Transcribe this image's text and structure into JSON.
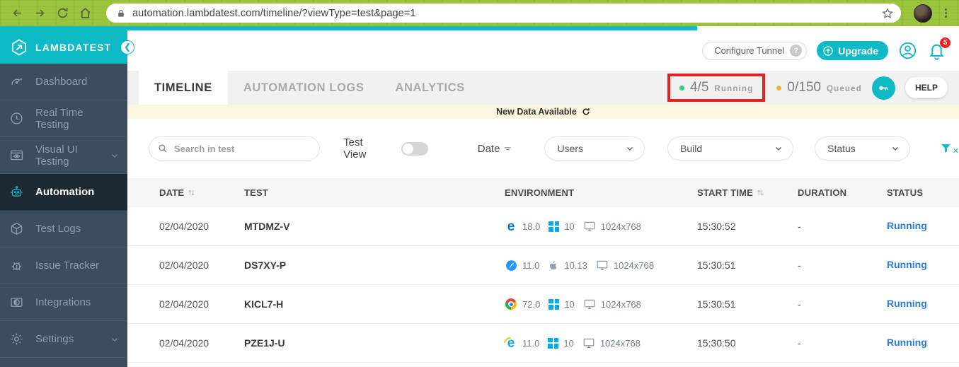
{
  "browser_chrome": {
    "url": "automation.lambdatest.com/timeline/?viewType=test&page=1"
  },
  "sidebar": {
    "brand": "LAMBDATEST",
    "items": [
      {
        "label": "Dashboard",
        "icon": "dashboard-icon",
        "active": false,
        "chevron": false
      },
      {
        "label": "Real Time Testing",
        "icon": "real-time-icon",
        "active": false,
        "chevron": false
      },
      {
        "label": "Visual UI Testing",
        "icon": "visual-ui-icon",
        "active": false,
        "chevron": true
      },
      {
        "label": "Automation",
        "icon": "automation-icon",
        "active": true,
        "chevron": false
      },
      {
        "label": "Test Logs",
        "icon": "test-logs-icon",
        "active": false,
        "chevron": false
      },
      {
        "label": "Issue Tracker",
        "icon": "issue-tracker-icon",
        "active": false,
        "chevron": false
      },
      {
        "label": "Integrations",
        "icon": "integrations-icon",
        "active": false,
        "chevron": false
      },
      {
        "label": "Settings",
        "icon": "settings-icon",
        "active": false,
        "chevron": true
      }
    ]
  },
  "topbar": {
    "configure_tunnel_label": "Configure Tunnel",
    "upgrade_label": "Upgrade",
    "notification_count": "5"
  },
  "tabs": [
    {
      "label": "TIMELINE",
      "active": true
    },
    {
      "label": "AUTOMATION LOGS",
      "active": false
    },
    {
      "label": "ANALYTICS",
      "active": false
    }
  ],
  "counters": {
    "running_value": "4/5",
    "running_label": "Running",
    "queued_value": "0/150",
    "queued_label": "Queued",
    "help_label": "HELP"
  },
  "banner": {
    "text": "New Data Available"
  },
  "filters": {
    "search_placeholder": "Search in test",
    "test_view_label": "Test View",
    "date_label": "Date",
    "dropdowns": [
      {
        "label": "Users"
      },
      {
        "label": "Build"
      },
      {
        "label": "Status"
      }
    ]
  },
  "table": {
    "columns": [
      {
        "label": "DATE",
        "sortable": true
      },
      {
        "label": "TEST",
        "sortable": false
      },
      {
        "label": "ENVIRONMENT",
        "sortable": false
      },
      {
        "label": "START TIME",
        "sortable": true
      },
      {
        "label": "DURATION",
        "sortable": false
      },
      {
        "label": "STATUS",
        "sortable": false
      }
    ],
    "rows": [
      {
        "date": "02/04/2020",
        "test": "MTDMZ-V",
        "browser": "edge",
        "browser_version": "18.0",
        "os": "windows",
        "os_version": "10",
        "resolution": "1024x768",
        "start_time": "15:30:52",
        "duration": "-",
        "status": "Running"
      },
      {
        "date": "02/04/2020",
        "test": "DS7XY-P",
        "browser": "safari",
        "browser_version": "11.0",
        "os": "apple",
        "os_version": "10.13",
        "resolution": "1024x768",
        "start_time": "15:30:51",
        "duration": "-",
        "status": "Running"
      },
      {
        "date": "02/04/2020",
        "test": "KICL7-H",
        "browser": "chrome",
        "browser_version": "72.0",
        "os": "windows",
        "os_version": "10",
        "resolution": "1024x768",
        "start_time": "15:30:51",
        "duration": "-",
        "status": "Running"
      },
      {
        "date": "02/04/2020",
        "test": "PZE1J-U",
        "browser": "ie",
        "browser_version": "11.0",
        "os": "windows",
        "os_version": "10",
        "resolution": "1024x768",
        "start_time": "15:30:50",
        "duration": "-",
        "status": "Running"
      }
    ]
  },
  "annotation": {
    "color": "#e02424",
    "target": "running-counter"
  },
  "colors": {
    "accent": "#0ebac5",
    "chrome_green": "#9bc53d",
    "running_link": "#2b7de0",
    "notification_badge": "#e8262a",
    "running_dot": "#2dce89",
    "queued_dot": "#f0b429",
    "banner_bg": "#fbf6df",
    "sidebar_bg": "#3d4d60",
    "sidebar_active_bg": "#1e2936"
  }
}
